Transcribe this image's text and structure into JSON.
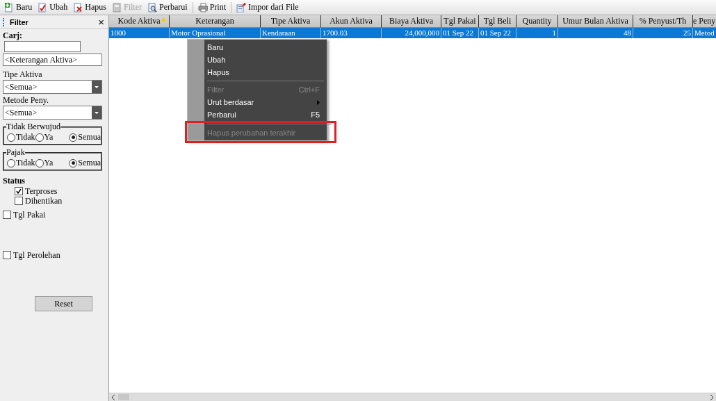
{
  "toolbar": [
    {
      "label": "Baru",
      "disabled": false
    },
    {
      "label": "Ubah",
      "disabled": false
    },
    {
      "label": "Hapus",
      "disabled": false
    },
    {
      "label": "Filter",
      "disabled": true
    },
    {
      "label": "Perbarui",
      "disabled": false
    },
    {
      "label": "Print",
      "disabled": false
    },
    {
      "label": "Impor dari File",
      "disabled": false
    }
  ],
  "filter": {
    "title": "Filter",
    "close": "×",
    "search_label": "Carj:",
    "search_value_placeholder": "<Keterangan Aktiva>",
    "dropdowns": [
      {
        "label": "Tipe Aktiva",
        "value": "<Semua>"
      },
      {
        "label": "Metode Peny.",
        "value": "<Semua>"
      }
    ],
    "radio_groups": [
      {
        "label": "Tidak Berwujud",
        "options": [
          {
            "label": "Tidak",
            "selected": false
          },
          {
            "label": "Ya",
            "selected": false
          },
          {
            "label": "Semua",
            "selected": true
          }
        ]
      },
      {
        "label": "Pajak",
        "options": [
          {
            "label": "Tidak",
            "selected": false
          },
          {
            "label": "Ya",
            "selected": false
          },
          {
            "label": "Semua",
            "selected": true
          }
        ]
      }
    ],
    "status_label": "Status",
    "status": [
      {
        "label": "Terproses",
        "checked": true
      },
      {
        "label": "Dihentikan",
        "checked": false
      }
    ],
    "date_filters": [
      {
        "label": "Tgl Pakai",
        "checked": false
      },
      {
        "label": "Tgl Perolehan",
        "checked": false
      }
    ],
    "reset": "Reset"
  },
  "table": {
    "columns": [
      {
        "label": "Kode Aktiva",
        "kind": "text",
        "sorted": true
      },
      {
        "label": "Keterangan",
        "kind": "text",
        "sorted": false
      },
      {
        "label": "Tipe Aktiva",
        "kind": "text",
        "sorted": false
      },
      {
        "label": "Akun Aktiva",
        "kind": "text",
        "sorted": false
      },
      {
        "label": "Biaya Aktiva",
        "kind": "number",
        "sorted": false
      },
      {
        "label": "Tgl Pakai",
        "kind": "text",
        "sorted": false
      },
      {
        "label": "Tgl Beli",
        "kind": "text",
        "sorted": false
      },
      {
        "label": "Quantity",
        "kind": "number",
        "sorted": false
      },
      {
        "label": "Umur Bulan Aktiva",
        "kind": "number",
        "sorted": false
      },
      {
        "label": "% Penyust/Th",
        "kind": "number",
        "sorted": false
      },
      {
        "label": "e Peny",
        "kind": "text",
        "sorted": false
      }
    ],
    "rows": [
      {
        "selected": true,
        "cells": [
          "1000",
          "Motor Oprasional",
          "Kendaraan",
          "1700.03",
          "24,000,000",
          "01 Sep 22",
          "01 Sep 22",
          "1",
          "48",
          "25",
          "Metod"
        ]
      }
    ]
  },
  "context_menu": {
    "items": [
      {
        "kind": "item",
        "label": "Baru",
        "disabled": false
      },
      {
        "kind": "item",
        "label": "Ubah",
        "disabled": false
      },
      {
        "kind": "item",
        "label": "Hapus",
        "disabled": false
      },
      {
        "kind": "separator"
      },
      {
        "kind": "item",
        "label": "Filter",
        "shortcut": "Ctrl+F",
        "disabled": true
      },
      {
        "kind": "submenu",
        "label": "Urut berdasar",
        "disabled": false
      },
      {
        "kind": "item",
        "label": "Perbarui",
        "shortcut": "F5",
        "disabled": false
      },
      {
        "kind": "separator"
      },
      {
        "kind": "item",
        "label": "Hapus perubahan terakhir",
        "disabled": true
      }
    ],
    "highlighted_last": true
  }
}
